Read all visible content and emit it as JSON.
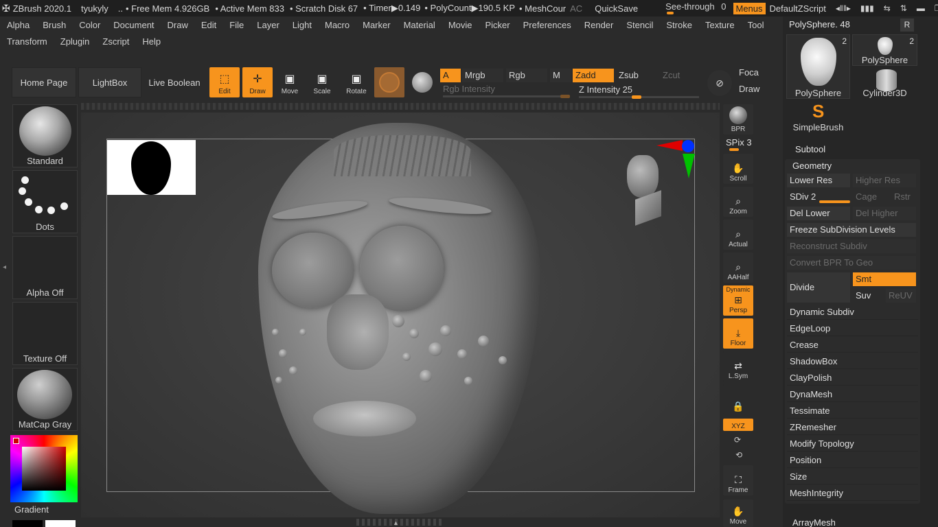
{
  "titlebar": {
    "app": "ZBrush 2020.1",
    "user": "tyukyly",
    "ellipsis": "..",
    "free_mem": "• Free Mem 4.926GB",
    "active_mem": "• Active Mem 833",
    "scratch": "• Scratch Disk 67",
    "timer": "• Timer▶0.149",
    "polycount": "• PolyCount▶190.5 KP",
    "meshcount": "• MeshCour",
    "ac": "AC",
    "quicksave": "QuickSave",
    "seethrough_label": "See-through",
    "seethrough_value": "0",
    "menus": "Menus",
    "script": "DefaultZScript"
  },
  "menu_row1": [
    "Alpha",
    "Brush",
    "Color",
    "Document",
    "Draw",
    "Edit",
    "File",
    "Layer",
    "Light",
    "Macro",
    "Marker",
    "Material",
    "Movie",
    "Picker",
    "Preferences",
    "Render",
    "Stencil",
    "Stroke",
    "Texture",
    "Tool"
  ],
  "menu_row2": [
    "Transform",
    "Zplugin",
    "Zscript",
    "Help"
  ],
  "toolbar": {
    "home": "Home Page",
    "lightbox": "LightBox",
    "live_boolean": "Live Boolean",
    "edit": "Edit",
    "draw": "Draw",
    "move": "Move",
    "scale": "Scale",
    "rotate": "Rotate",
    "channel_a": "A",
    "mrgb": "Mrgb",
    "rgb": "Rgb",
    "m": "M",
    "zadd": "Zadd",
    "zsub": "Zsub",
    "zcut": "Zcut",
    "rgb_intensity": "Rgb Intensity",
    "z_intensity": "Z Intensity 25",
    "focal": "Foca",
    "draw_size": "Draw"
  },
  "left_shelf": {
    "brush": "Standard",
    "stroke": "Dots",
    "alpha": "Alpha Off",
    "texture": "Texture Off",
    "material": "MatCap Gray",
    "gradient": "Gradient"
  },
  "right_shelf": {
    "bpr": "BPR",
    "spix": "SPix 3",
    "scroll": "Scroll",
    "zoom": "Zoom",
    "actual": "Actual",
    "aahalf": "AAHalf",
    "dynamic": "Dynamic",
    "persp": "Persp",
    "floor": "Floor",
    "lsym": "L.Sym",
    "xyz": "XYZ",
    "frame": "Frame",
    "move": "Move"
  },
  "tool_palette": {
    "current": "PolySphere. 48",
    "r_label": "R",
    "tools": [
      {
        "name": "PolySphere",
        "count": "2"
      },
      {
        "name": "PolySphere",
        "count": "2"
      },
      {
        "name": "Cylinder3D",
        "count": ""
      },
      {
        "name": "SimpleBrush",
        "count": ""
      }
    ],
    "subtool": "Subtool",
    "geometry": "Geometry",
    "lower_res": "Lower Res",
    "higher_res": "Higher Res",
    "sdiv": "SDiv 2",
    "cage": "Cage",
    "rstr": "Rstr",
    "del_lower": "Del Lower",
    "del_higher": "Del Higher",
    "freeze": "Freeze SubDivision Levels",
    "reconstruct": "Reconstruct Subdiv",
    "convert_bpr": "Convert BPR To Geo",
    "divide": "Divide",
    "smt": "Smt",
    "suv": "Suv",
    "reuv": "ReUV",
    "items": [
      "Dynamic Subdiv",
      "EdgeLoop",
      "Crease",
      "ShadowBox",
      "ClayPolish",
      "DynaMesh",
      "Tessimate",
      "ZRemesher",
      "Modify Topology",
      "Position",
      "Size",
      "MeshIntegrity"
    ],
    "arraymesh": "ArrayMesh"
  },
  "colors": {
    "accent": "#f7941d",
    "bg": "#2b2b2b"
  }
}
